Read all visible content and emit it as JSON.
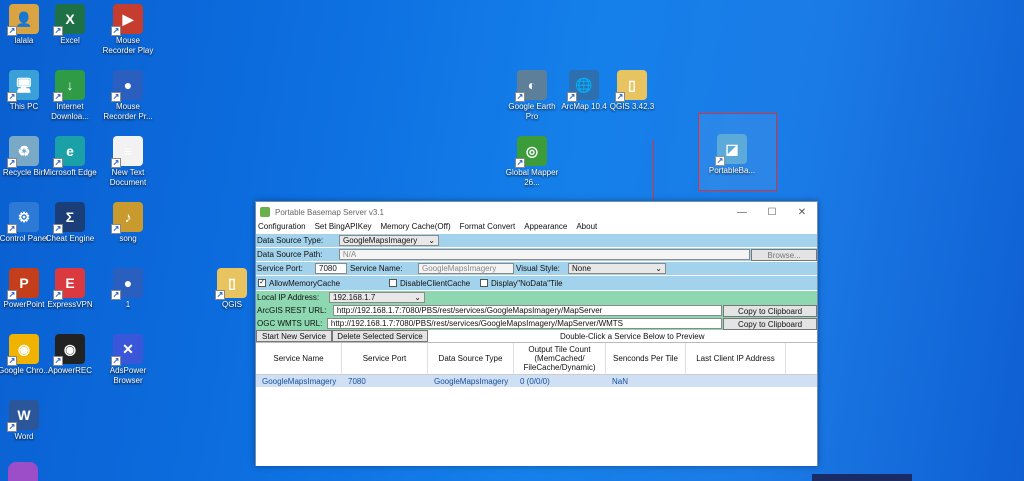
{
  "desktop": {
    "icons": [
      {
        "label": "lalala",
        "glyph": "👤",
        "color": "#d9a441"
      },
      {
        "label": "Excel",
        "glyph": "X",
        "color": "#1e7145"
      },
      {
        "label": "Mouse Recorder Play",
        "glyph": "▶",
        "color": "#c53d2f"
      },
      {
        "label": "This PC",
        "glyph": "🖥",
        "color": "#3aa0d8"
      },
      {
        "label": "Internet Downloa...",
        "glyph": "↓",
        "color": "#2f9b46"
      },
      {
        "label": "Mouse Recorder Pr...",
        "glyph": "●",
        "color": "#2a5fbf"
      },
      {
        "label": "Recycle Bin",
        "glyph": "♻",
        "color": "#7aa8c7"
      },
      {
        "label": "Microsoft Edge",
        "glyph": "e",
        "color": "#1aa1a8"
      },
      {
        "label": "New Text Document",
        "glyph": "≡",
        "color": "#f2f2f2"
      },
      {
        "label": "Control Panel",
        "glyph": "⚙",
        "color": "#2d7ad6"
      },
      {
        "label": "Cheat Engine",
        "glyph": "Σ",
        "color": "#1b3e78"
      },
      {
        "label": "song",
        "glyph": "♪",
        "color": "#c99b2e"
      },
      {
        "label": "PowerPoint",
        "glyph": "P",
        "color": "#c43e1c"
      },
      {
        "label": "ExpressVPN",
        "glyph": "E",
        "color": "#da3940"
      },
      {
        "label": "1",
        "glyph": "●",
        "color": "#2a5fbf"
      },
      {
        "label": "Google Chro...",
        "glyph": "◉",
        "color": "#f0b400"
      },
      {
        "label": "ApowerREC",
        "glyph": "◉",
        "color": "#222"
      },
      {
        "label": "AdsPower Browser",
        "glyph": "✕",
        "color": "#3b57d9"
      },
      {
        "label": "Word",
        "glyph": "W",
        "color": "#2b579a"
      },
      {
        "label": "QGIS",
        "glyph": "▯",
        "color": "#e8c460"
      },
      {
        "label": "Google Earth Pro",
        "glyph": "◐",
        "color": "#5d7f99"
      },
      {
        "label": "ArcMap 10.4",
        "glyph": "🌐",
        "color": "#2e6fb0"
      },
      {
        "label": "QGIS 3.42.3",
        "glyph": "▯",
        "color": "#e8c460"
      },
      {
        "label": "Global Mapper 26...",
        "glyph": "◎",
        "color": "#3c9c3a"
      },
      {
        "label": "PortableBa...",
        "glyph": "◪",
        "color": "#4fa3d6"
      }
    ]
  },
  "window": {
    "title": "Portable Basemap Server v3.1",
    "controls": {
      "minimize": "—",
      "maximize": "☐",
      "close": "✕"
    },
    "menu": [
      "Configuration",
      "Set BingAPIKey",
      "Memory Cache(Off)",
      "Format Convert",
      "Appearance",
      "About"
    ],
    "data_source_type_label": "Data Source Type:",
    "data_source_type_value": "GoogleMapsImagery",
    "data_source_path_label": "Data Source Path:",
    "data_source_path_value": "N/A",
    "browse_label": "Browse...",
    "service_port_label": "Service Port:",
    "service_port_value": "7080",
    "service_name_label": "Service Name:",
    "service_name_value": "GoogleMapsImagery",
    "visual_style_label": "Visual Style:",
    "visual_style_value": "None",
    "allow_memory_cache": "AllowMemoryCache",
    "disable_client_cache": "DisableClientCache",
    "display_nodata_tile": "Display\"NoData\"Tile",
    "local_ip_label": "Local IP Address:",
    "local_ip_value": "192.168.1.7",
    "arcgis_label": "ArcGIS REST URL:",
    "arcgis_url": "http://192.168.1.7:7080/PBS/rest/services/GoogleMapsImagery/MapServer",
    "ogc_label": "OGC WMTS URL:",
    "ogc_url": "http://192.168.1.7:7080/PBS/rest/services/GoogleMapsImagery/MapServer/WMTS",
    "copy_label": "Copy to Clipboard",
    "start_label": "Start New Service",
    "delete_label": "Delete Selected Service",
    "hint": "Double-Click a Service Below to Preview",
    "table": {
      "headers": [
        "Service Name",
        "Service Port",
        "Data Source Type",
        "Output Tile Count (MemCached/ FileCache/Dynamic)",
        "Senconds Per Tile",
        "Last Client IP Address"
      ],
      "rows": [
        [
          "GoogleMapsImagery",
          "7080",
          "GoogleMapsImagery",
          "0 (0/0/0)",
          "NaN",
          ""
        ]
      ]
    }
  }
}
